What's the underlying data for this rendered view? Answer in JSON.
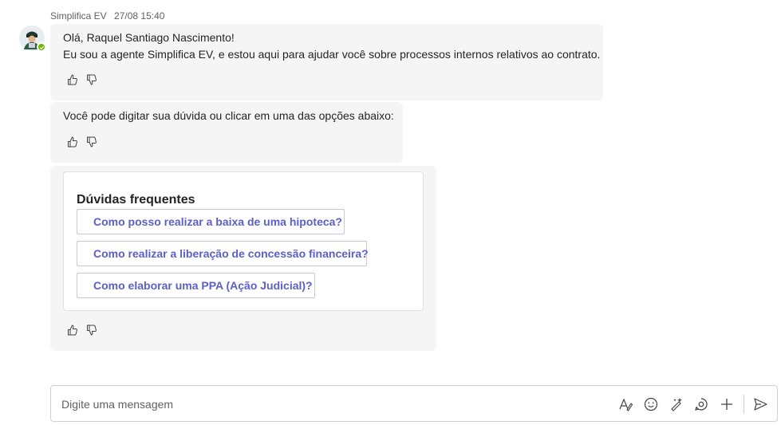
{
  "message": {
    "sender": "Simplifica EV",
    "timestamp": "27/08 15:40"
  },
  "bubble1": {
    "line1": "Olá, Raquel Santiago Nascimento!",
    "line2": "Eu sou a agente Simplifica EV, e estou aqui para ajudar você sobre processos internos relativos ao contrato."
  },
  "bubble2": {
    "text": "Você pode digitar sua dúvida ou clicar em uma das opções abaixo:"
  },
  "card": {
    "title": "Dúvidas frequentes",
    "options": [
      "Como posso realizar a baixa de uma hipoteca?",
      "Como realizar a liberação de concessão financeira?",
      "Como elaborar uma PPA (Ação Judicial)?"
    ]
  },
  "composer": {
    "placeholder": "Digite uma mensagem",
    "icons": [
      "format-icon",
      "emoji-icon",
      "copilot-icon",
      "loop-icon",
      "add-icon",
      "send-icon"
    ]
  },
  "colors": {
    "bubble_bg": "#f5f5f5",
    "accent": "#5b5fc7",
    "presence": "#6bb700"
  }
}
